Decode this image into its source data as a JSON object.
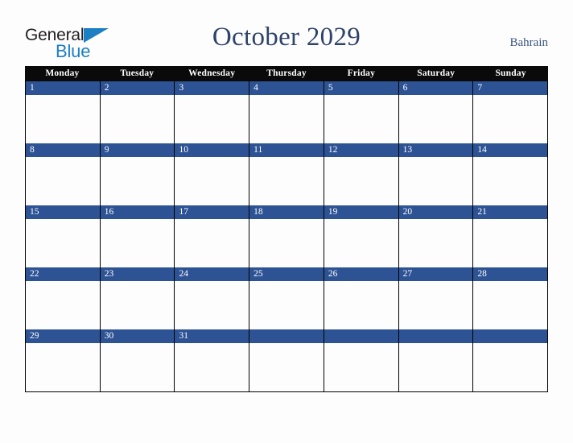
{
  "brand": {
    "name_part1": "General",
    "name_part2": "Blue",
    "triangle_icon": "triangle-icon",
    "color_dark": "#231f20",
    "color_blue": "#1b7fc4"
  },
  "header": {
    "title": "October 2029",
    "country": "Bahrain",
    "title_color": "#2e4369",
    "country_color": "#3a5580"
  },
  "calendar": {
    "month": "October",
    "year": "2029",
    "weekday_header_bg": "#0a0a0a",
    "weekday_header_color": "#ffffff",
    "date_bar_bg": "#2e5395",
    "date_bar_color": "#ffffff",
    "cell_bg": "#fdfdfd",
    "border_color": "#000000",
    "weekdays": [
      "Monday",
      "Tuesday",
      "Wednesday",
      "Thursday",
      "Friday",
      "Saturday",
      "Sunday"
    ],
    "weeks": [
      {
        "days": [
          {
            "date": "1"
          },
          {
            "date": "2"
          },
          {
            "date": "3"
          },
          {
            "date": "4"
          },
          {
            "date": "5"
          },
          {
            "date": "6"
          },
          {
            "date": "7"
          }
        ]
      },
      {
        "days": [
          {
            "date": "8"
          },
          {
            "date": "9"
          },
          {
            "date": "10"
          },
          {
            "date": "11"
          },
          {
            "date": "12"
          },
          {
            "date": "13"
          },
          {
            "date": "14"
          }
        ]
      },
      {
        "days": [
          {
            "date": "15"
          },
          {
            "date": "16"
          },
          {
            "date": "17"
          },
          {
            "date": "18"
          },
          {
            "date": "19"
          },
          {
            "date": "20"
          },
          {
            "date": "21"
          }
        ]
      },
      {
        "days": [
          {
            "date": "22"
          },
          {
            "date": "23"
          },
          {
            "date": "24"
          },
          {
            "date": "25"
          },
          {
            "date": "26"
          },
          {
            "date": "27"
          },
          {
            "date": "28"
          }
        ]
      },
      {
        "days": [
          {
            "date": "29"
          },
          {
            "date": "30"
          },
          {
            "date": "31"
          },
          {
            "date": ""
          },
          {
            "date": ""
          },
          {
            "date": ""
          },
          {
            "date": ""
          }
        ]
      }
    ]
  }
}
